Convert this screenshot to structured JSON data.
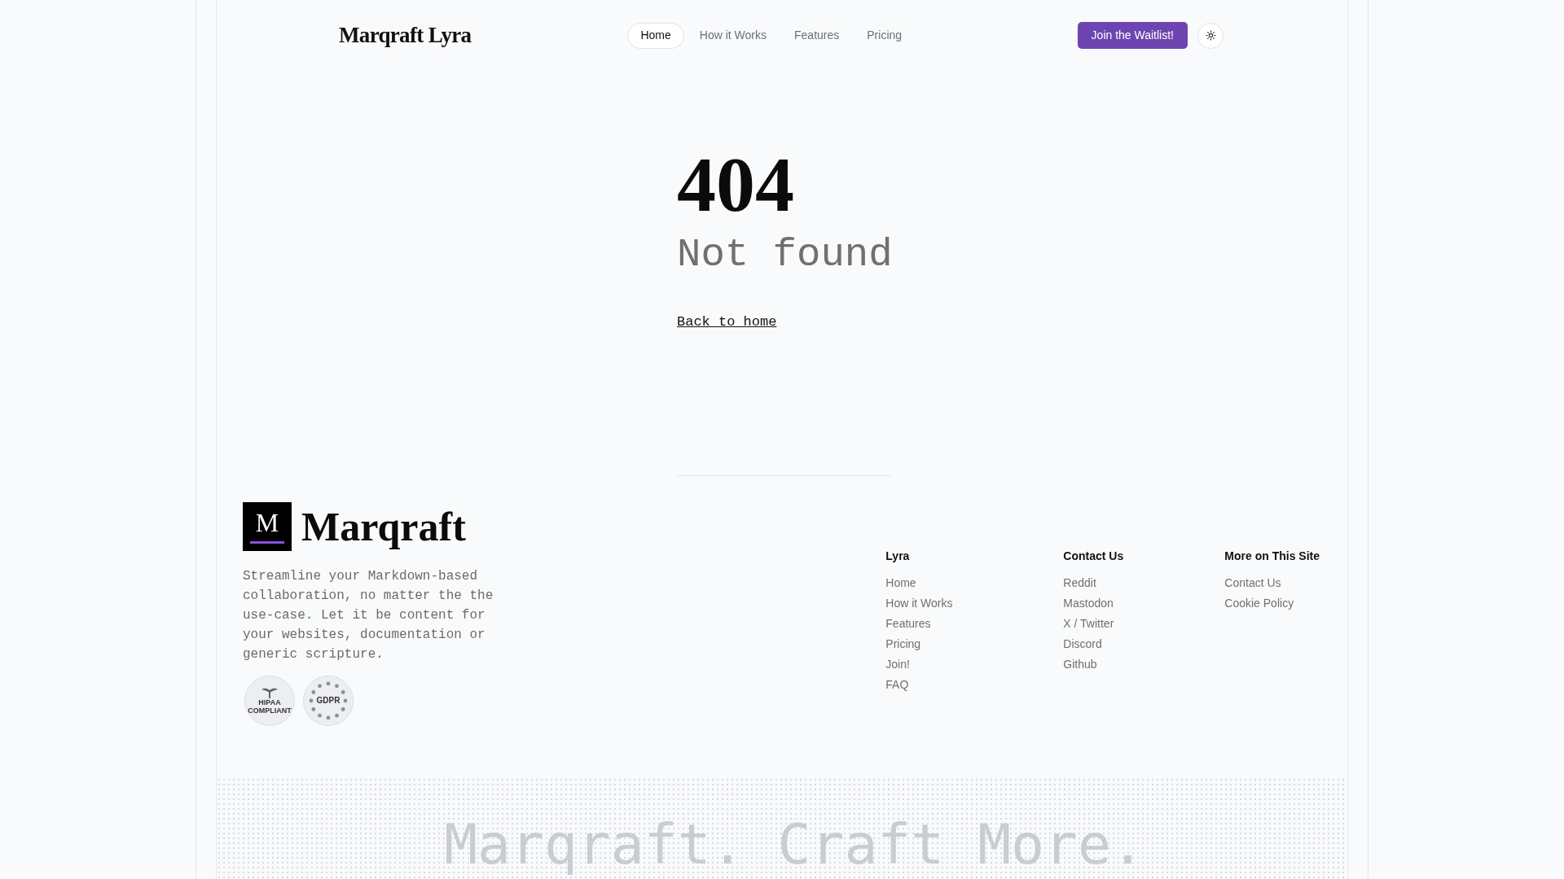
{
  "header": {
    "brand": "Marqraft Lyra",
    "nav": [
      {
        "label": "Home",
        "selected": true
      },
      {
        "label": "How it Works",
        "selected": false
      },
      {
        "label": "Features",
        "selected": false
      },
      {
        "label": "Pricing",
        "selected": false
      }
    ],
    "cta": "Join the Waitlist!"
  },
  "error": {
    "code": "404",
    "message": "Not found",
    "link": "Back to home"
  },
  "footer": {
    "logo_letter": "M",
    "logo_text": "Marqraft",
    "description": "Streamline your Markdown-based collaboration, no matter the the use-case. Let it be content for your websites, documentation or generic scripture.",
    "badges": [
      {
        "kind": "hipaa",
        "text": "HIPAA COMPLIANT"
      },
      {
        "kind": "gdpr",
        "text": "GDPR"
      }
    ],
    "columns": [
      {
        "title": "Lyra",
        "links": [
          "Home",
          "How it Works",
          "Features",
          "Pricing",
          "Join!",
          "FAQ"
        ]
      },
      {
        "title": "Contact Us",
        "links": [
          "Reddit",
          "Mastodon",
          "X / Twitter",
          "Discord",
          "Github"
        ]
      },
      {
        "title": "More on This Site",
        "links": [
          "Contact Us",
          "Cookie Policy"
        ]
      }
    ]
  },
  "banner": "Marqraft. Craft More."
}
